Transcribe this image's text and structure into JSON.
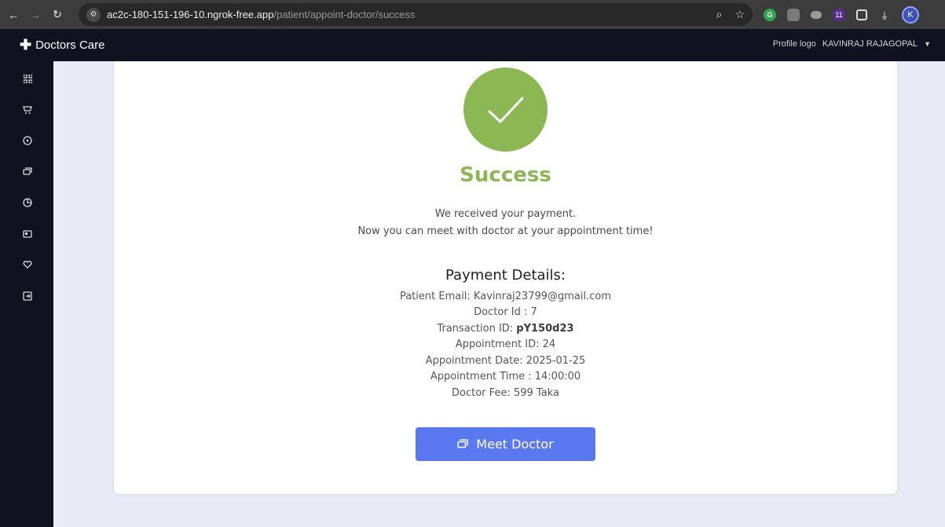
{
  "browser": {
    "url_host": "ac2c-180-151-196-10.ngrok-free.app",
    "url_path": "/patient/appoint-doctor/success",
    "site_icon": "site-settings-icon",
    "badge_count": "11",
    "avatar_letter": "K"
  },
  "header": {
    "brand": "Doctors Care",
    "profile_logo_alt": "Profile logo",
    "user_name": "KAVINRAJ RAJAGOPAL"
  },
  "sidebar": {
    "icons": [
      "dashboard-icon",
      "cart-icon",
      "play-circle-icon",
      "chat-icon",
      "pie-chart-icon",
      "id-card-icon",
      "heart-icon",
      "logout-icon"
    ]
  },
  "content": {
    "title": "Success",
    "message_line1": "We received your payment.",
    "message_line2": "Now you can meet with doctor at your appointment time!",
    "details_title": "Payment Details:",
    "patient_email": "Patient Email: Kavinraj23799@gmail.com",
    "doctor_id": "Doctor Id : 7",
    "transaction_label": "Transaction ID: ",
    "transaction_id": "pY150d23",
    "appointment_id": "Appointment ID: 24",
    "appointment_date": "Appointment Date: 2025-01-25",
    "appointment_time": "Appointment Time : 14:00:00",
    "doctor_fee": "Doctor Fee: 599 Taka",
    "meet_button": "Meet Doctor"
  },
  "colors": {
    "success_green": "#8bb852",
    "button_blue": "#5a78f0",
    "sidebar_bg": "#11121f",
    "page_bg": "#e8ebf5"
  }
}
